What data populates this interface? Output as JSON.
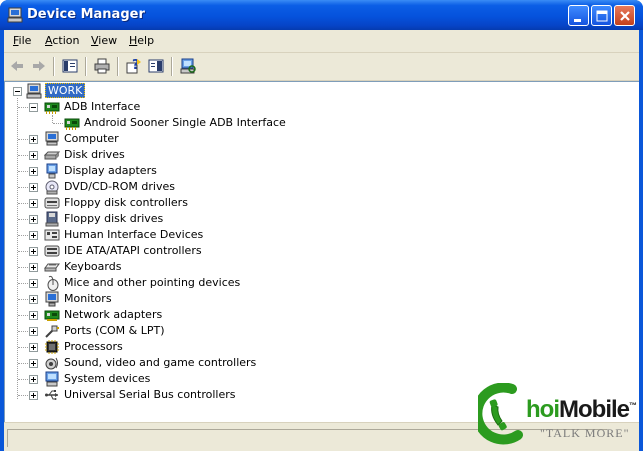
{
  "window": {
    "title": "Device Manager"
  },
  "menu": [
    {
      "id": "file",
      "first": "F",
      "rest": "ile"
    },
    {
      "id": "action",
      "first": "A",
      "rest": "ction"
    },
    {
      "id": "view",
      "first": "V",
      "rest": "iew"
    },
    {
      "id": "help",
      "first": "H",
      "rest": "elp"
    }
  ],
  "toolbar": [
    "back-icon",
    "forward-icon",
    "show-hide-tree-icon",
    "print-icon",
    "help-icon",
    "properties-icon",
    "scan-hardware-icon"
  ],
  "tree": {
    "root": "WORK",
    "expanded": {
      "label": "ADB Interface",
      "child": "Android Sooner Single ADB Interface"
    },
    "items": [
      {
        "label": "Computer",
        "icon": "computer-icon"
      },
      {
        "label": "Disk drives",
        "icon": "disk-drive-icon"
      },
      {
        "label": "Display adapters",
        "icon": "display-adapter-icon"
      },
      {
        "label": "DVD/CD-ROM drives",
        "icon": "cdrom-icon"
      },
      {
        "label": "Floppy disk controllers",
        "icon": "floppy-controller-icon"
      },
      {
        "label": "Floppy disk drives",
        "icon": "floppy-drive-icon"
      },
      {
        "label": "Human Interface Devices",
        "icon": "hid-icon"
      },
      {
        "label": "IDE ATA/ATAPI controllers",
        "icon": "ide-controller-icon"
      },
      {
        "label": "Keyboards",
        "icon": "keyboard-icon"
      },
      {
        "label": "Mice and other pointing devices",
        "icon": "mouse-icon"
      },
      {
        "label": "Monitors",
        "icon": "monitor-icon"
      },
      {
        "label": "Network adapters",
        "icon": "network-adapter-icon"
      },
      {
        "label": "Ports (COM & LPT)",
        "icon": "port-icon"
      },
      {
        "label": "Processors",
        "icon": "processor-icon"
      },
      {
        "label": "Sound, video and game controllers",
        "icon": "sound-icon"
      },
      {
        "label": "System devices",
        "icon": "system-device-icon"
      },
      {
        "label": "Universal Serial Bus controllers",
        "icon": "usb-icon"
      }
    ]
  },
  "watermark": {
    "prefix": "hoi",
    "name": "Mobile",
    "tm": "™",
    "tagline": "\"TALK MORE\""
  },
  "colors": {
    "title_bar": "#0552dc",
    "selection": "#316ac5",
    "face": "#ece9d8",
    "brand_green": "#2c9b1f"
  }
}
